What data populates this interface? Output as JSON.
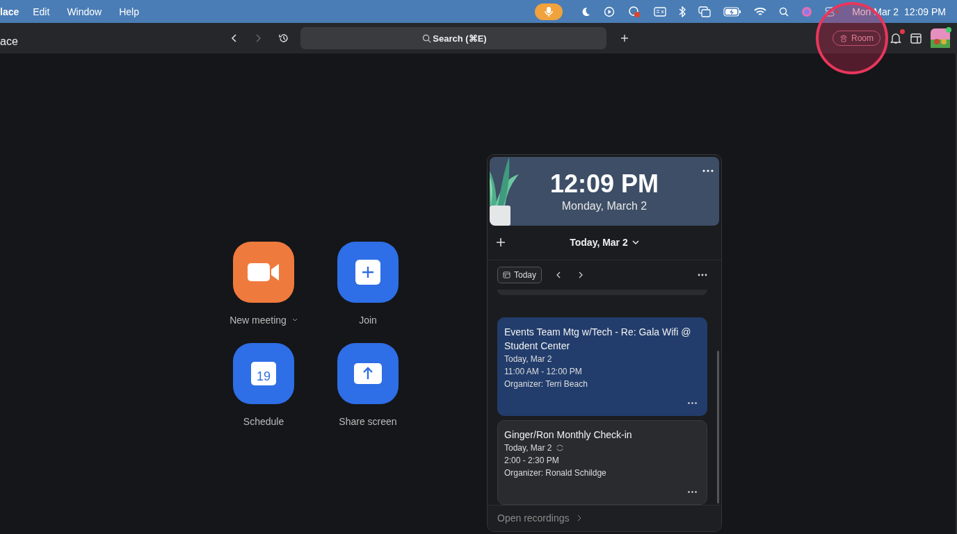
{
  "menu_bar": {
    "app_name": "lace",
    "items": [
      "Edit",
      "Window",
      "Help"
    ],
    "date": "Mon Mar 2",
    "time": "12:09 PM"
  },
  "toolbar": {
    "title": "ace",
    "search": {
      "placeholder": "Search (⌘E)"
    },
    "room_button": "Room",
    "notification_badge": true,
    "status_online": true
  },
  "actions": [
    {
      "kind": "video",
      "label": "New meeting",
      "has_menu": true,
      "color": "#ef7a3d"
    },
    {
      "kind": "join",
      "label": "Join",
      "has_menu": false,
      "color": "#2e6ee6"
    },
    {
      "kind": "calendar",
      "label": "Schedule",
      "has_menu": false,
      "color": "#2e6ee6",
      "icon_text": "19"
    },
    {
      "kind": "share",
      "label": "Share screen",
      "has_menu": false,
      "color": "#2e6ee6"
    }
  ],
  "calendar_panel": {
    "time": "12:09 PM",
    "date": "Monday, March 2",
    "day_picker": "Today, Mar 2",
    "today_button": "Today",
    "events": [
      {
        "title": "Events Team Mtg w/Tech - Re: Gala Wifi @ Student Center",
        "date": "Today, Mar 2",
        "recurring": false,
        "time": "11:00 AM - 12:00 PM",
        "organizer": "Organizer: Terri Beach",
        "selected": true
      },
      {
        "title": "Ginger/Ron Monthly Check-in",
        "date": "Today, Mar 2",
        "recurring": true,
        "time": "2:00 - 2:30 PM",
        "organizer": "Organizer: Ronald Schildge",
        "selected": false
      }
    ],
    "footer_link": "Open recordings"
  }
}
